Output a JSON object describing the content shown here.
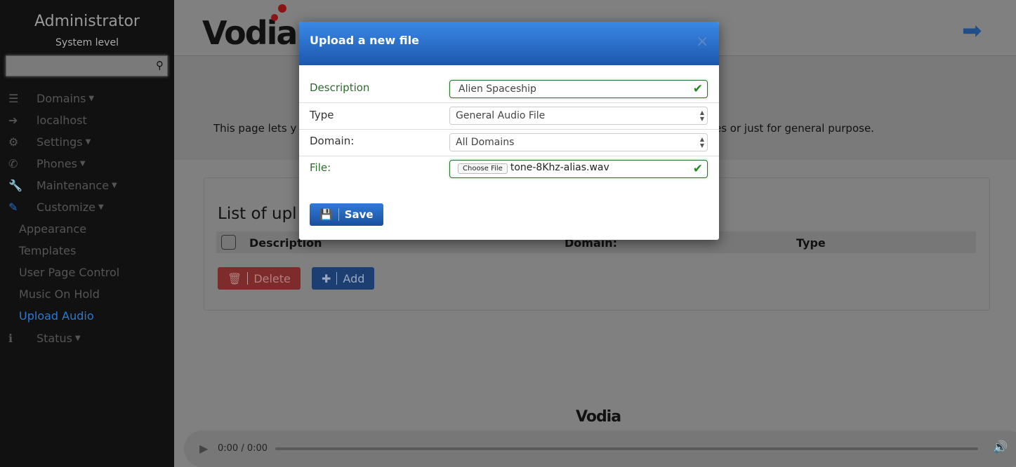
{
  "sidebar": {
    "title": "Administrator",
    "subtitle": "System level",
    "search_placeholder": "",
    "items": [
      {
        "label": "Domains",
        "icon": "list-icon",
        "caret": true
      },
      {
        "label": "localhost",
        "icon": "arrow-circle-icon"
      },
      {
        "label": "Settings",
        "icon": "gears-icon",
        "caret": true
      },
      {
        "label": "Phones",
        "icon": "phone-icon",
        "caret": true
      },
      {
        "label": "Maintenance",
        "icon": "wrench-icon",
        "caret": true
      },
      {
        "label": "Customize",
        "icon": "brush-icon",
        "caret": true
      }
    ],
    "sub_items": [
      {
        "label": "Appearance"
      },
      {
        "label": "Templates"
      },
      {
        "label": "User Page Control"
      },
      {
        "label": "Music On Hold"
      },
      {
        "label": "Upload Audio",
        "active": true
      }
    ],
    "status": {
      "label": "Status",
      "icon": "info-icon"
    }
  },
  "main": {
    "logo": "Vodia",
    "intro_left": "This page lets y",
    "intro_right": "es or just for general purpose.",
    "list_title": "List of upl",
    "columns": [
      "Description",
      "Domain:",
      "Type"
    ],
    "delete_label": "Delete",
    "add_label": "Add",
    "footer_logo": "Vodia",
    "audio_time": "0:00 / 0:00"
  },
  "modal": {
    "title": "Upload a new file",
    "close": "×",
    "description_label": "Description",
    "description_value": "Alien Spaceship",
    "type_label": "Type",
    "type_value": "General Audio File",
    "domain_label": "Domain:",
    "domain_value": "All Domains",
    "file_label": "File:",
    "choose_file": "Choose File",
    "file_name": "tone-8Khz-alias.wav",
    "save_label": "Save"
  },
  "colors": {
    "accent": "#2a7ad3",
    "modal_header": "#1d57ad",
    "valid": "#2e6b2e",
    "logo_dots": "#8b1515"
  }
}
